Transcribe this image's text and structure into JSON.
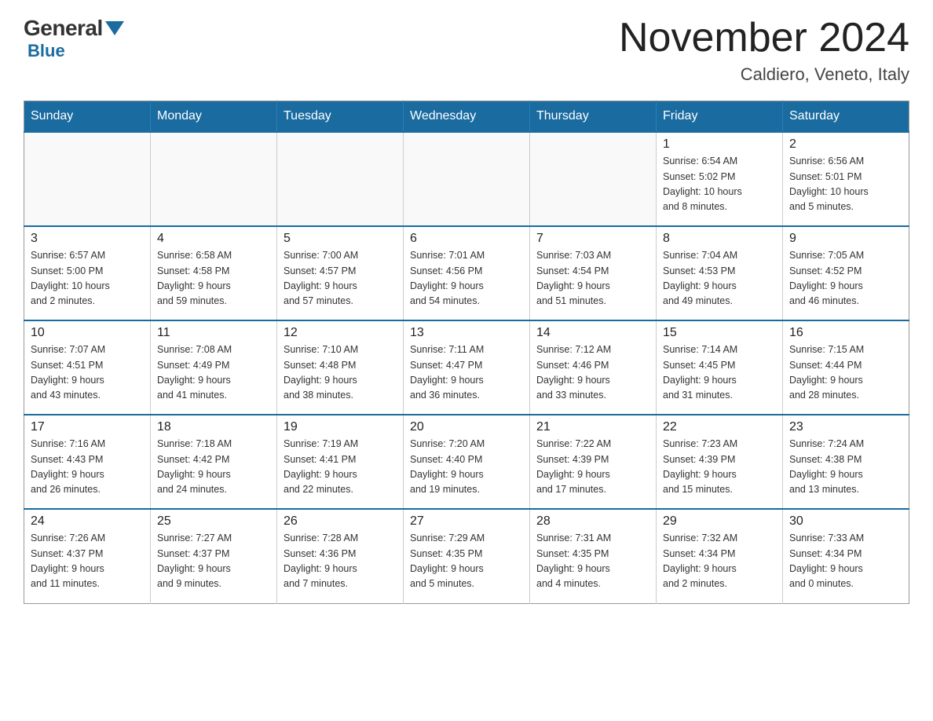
{
  "header": {
    "logo": {
      "general": "General",
      "blue": "Blue"
    },
    "title": "November 2024",
    "location": "Caldiero, Veneto, Italy"
  },
  "weekdays": [
    "Sunday",
    "Monday",
    "Tuesday",
    "Wednesday",
    "Thursday",
    "Friday",
    "Saturday"
  ],
  "weeks": [
    [
      {
        "day": "",
        "detail": ""
      },
      {
        "day": "",
        "detail": ""
      },
      {
        "day": "",
        "detail": ""
      },
      {
        "day": "",
        "detail": ""
      },
      {
        "day": "",
        "detail": ""
      },
      {
        "day": "1",
        "detail": "Sunrise: 6:54 AM\nSunset: 5:02 PM\nDaylight: 10 hours\nand 8 minutes."
      },
      {
        "day": "2",
        "detail": "Sunrise: 6:56 AM\nSunset: 5:01 PM\nDaylight: 10 hours\nand 5 minutes."
      }
    ],
    [
      {
        "day": "3",
        "detail": "Sunrise: 6:57 AM\nSunset: 5:00 PM\nDaylight: 10 hours\nand 2 minutes."
      },
      {
        "day": "4",
        "detail": "Sunrise: 6:58 AM\nSunset: 4:58 PM\nDaylight: 9 hours\nand 59 minutes."
      },
      {
        "day": "5",
        "detail": "Sunrise: 7:00 AM\nSunset: 4:57 PM\nDaylight: 9 hours\nand 57 minutes."
      },
      {
        "day": "6",
        "detail": "Sunrise: 7:01 AM\nSunset: 4:56 PM\nDaylight: 9 hours\nand 54 minutes."
      },
      {
        "day": "7",
        "detail": "Sunrise: 7:03 AM\nSunset: 4:54 PM\nDaylight: 9 hours\nand 51 minutes."
      },
      {
        "day": "8",
        "detail": "Sunrise: 7:04 AM\nSunset: 4:53 PM\nDaylight: 9 hours\nand 49 minutes."
      },
      {
        "day": "9",
        "detail": "Sunrise: 7:05 AM\nSunset: 4:52 PM\nDaylight: 9 hours\nand 46 minutes."
      }
    ],
    [
      {
        "day": "10",
        "detail": "Sunrise: 7:07 AM\nSunset: 4:51 PM\nDaylight: 9 hours\nand 43 minutes."
      },
      {
        "day": "11",
        "detail": "Sunrise: 7:08 AM\nSunset: 4:49 PM\nDaylight: 9 hours\nand 41 minutes."
      },
      {
        "day": "12",
        "detail": "Sunrise: 7:10 AM\nSunset: 4:48 PM\nDaylight: 9 hours\nand 38 minutes."
      },
      {
        "day": "13",
        "detail": "Sunrise: 7:11 AM\nSunset: 4:47 PM\nDaylight: 9 hours\nand 36 minutes."
      },
      {
        "day": "14",
        "detail": "Sunrise: 7:12 AM\nSunset: 4:46 PM\nDaylight: 9 hours\nand 33 minutes."
      },
      {
        "day": "15",
        "detail": "Sunrise: 7:14 AM\nSunset: 4:45 PM\nDaylight: 9 hours\nand 31 minutes."
      },
      {
        "day": "16",
        "detail": "Sunrise: 7:15 AM\nSunset: 4:44 PM\nDaylight: 9 hours\nand 28 minutes."
      }
    ],
    [
      {
        "day": "17",
        "detail": "Sunrise: 7:16 AM\nSunset: 4:43 PM\nDaylight: 9 hours\nand 26 minutes."
      },
      {
        "day": "18",
        "detail": "Sunrise: 7:18 AM\nSunset: 4:42 PM\nDaylight: 9 hours\nand 24 minutes."
      },
      {
        "day": "19",
        "detail": "Sunrise: 7:19 AM\nSunset: 4:41 PM\nDaylight: 9 hours\nand 22 minutes."
      },
      {
        "day": "20",
        "detail": "Sunrise: 7:20 AM\nSunset: 4:40 PM\nDaylight: 9 hours\nand 19 minutes."
      },
      {
        "day": "21",
        "detail": "Sunrise: 7:22 AM\nSunset: 4:39 PM\nDaylight: 9 hours\nand 17 minutes."
      },
      {
        "day": "22",
        "detail": "Sunrise: 7:23 AM\nSunset: 4:39 PM\nDaylight: 9 hours\nand 15 minutes."
      },
      {
        "day": "23",
        "detail": "Sunrise: 7:24 AM\nSunset: 4:38 PM\nDaylight: 9 hours\nand 13 minutes."
      }
    ],
    [
      {
        "day": "24",
        "detail": "Sunrise: 7:26 AM\nSunset: 4:37 PM\nDaylight: 9 hours\nand 11 minutes."
      },
      {
        "day": "25",
        "detail": "Sunrise: 7:27 AM\nSunset: 4:37 PM\nDaylight: 9 hours\nand 9 minutes."
      },
      {
        "day": "26",
        "detail": "Sunrise: 7:28 AM\nSunset: 4:36 PM\nDaylight: 9 hours\nand 7 minutes."
      },
      {
        "day": "27",
        "detail": "Sunrise: 7:29 AM\nSunset: 4:35 PM\nDaylight: 9 hours\nand 5 minutes."
      },
      {
        "day": "28",
        "detail": "Sunrise: 7:31 AM\nSunset: 4:35 PM\nDaylight: 9 hours\nand 4 minutes."
      },
      {
        "day": "29",
        "detail": "Sunrise: 7:32 AM\nSunset: 4:34 PM\nDaylight: 9 hours\nand 2 minutes."
      },
      {
        "day": "30",
        "detail": "Sunrise: 7:33 AM\nSunset: 4:34 PM\nDaylight: 9 hours\nand 0 minutes."
      }
    ]
  ]
}
